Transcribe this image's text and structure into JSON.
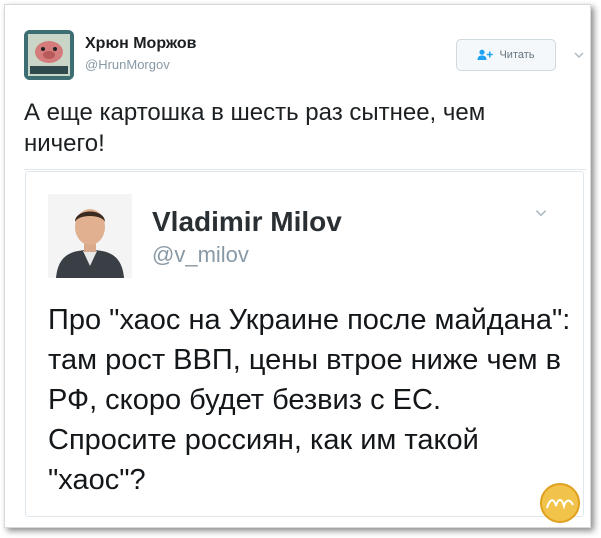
{
  "tweet": {
    "author_name": "Хрюн Моржов",
    "author_handle": "@HrunMorgov",
    "follow_label": "Читать",
    "text": "А еще картошка в шесть раз сытнее, чем ничего!"
  },
  "quoted_tweet": {
    "author_name": "Vladimir Milov",
    "author_handle": "@v_milov",
    "text": "Про \"хаос на Украине после майдана\": там рост ВВП, цены втрое ниже чем в РФ, скоро будет безвиз с ЕС. Спросите россиян, как им такой \"хаос\"?"
  },
  "icons": {
    "follow": "add-user-icon",
    "menu": "chevron-down-icon"
  },
  "colors": {
    "text": "#1c2022",
    "secondary": "#8899a6",
    "border": "#e1e8ed"
  }
}
